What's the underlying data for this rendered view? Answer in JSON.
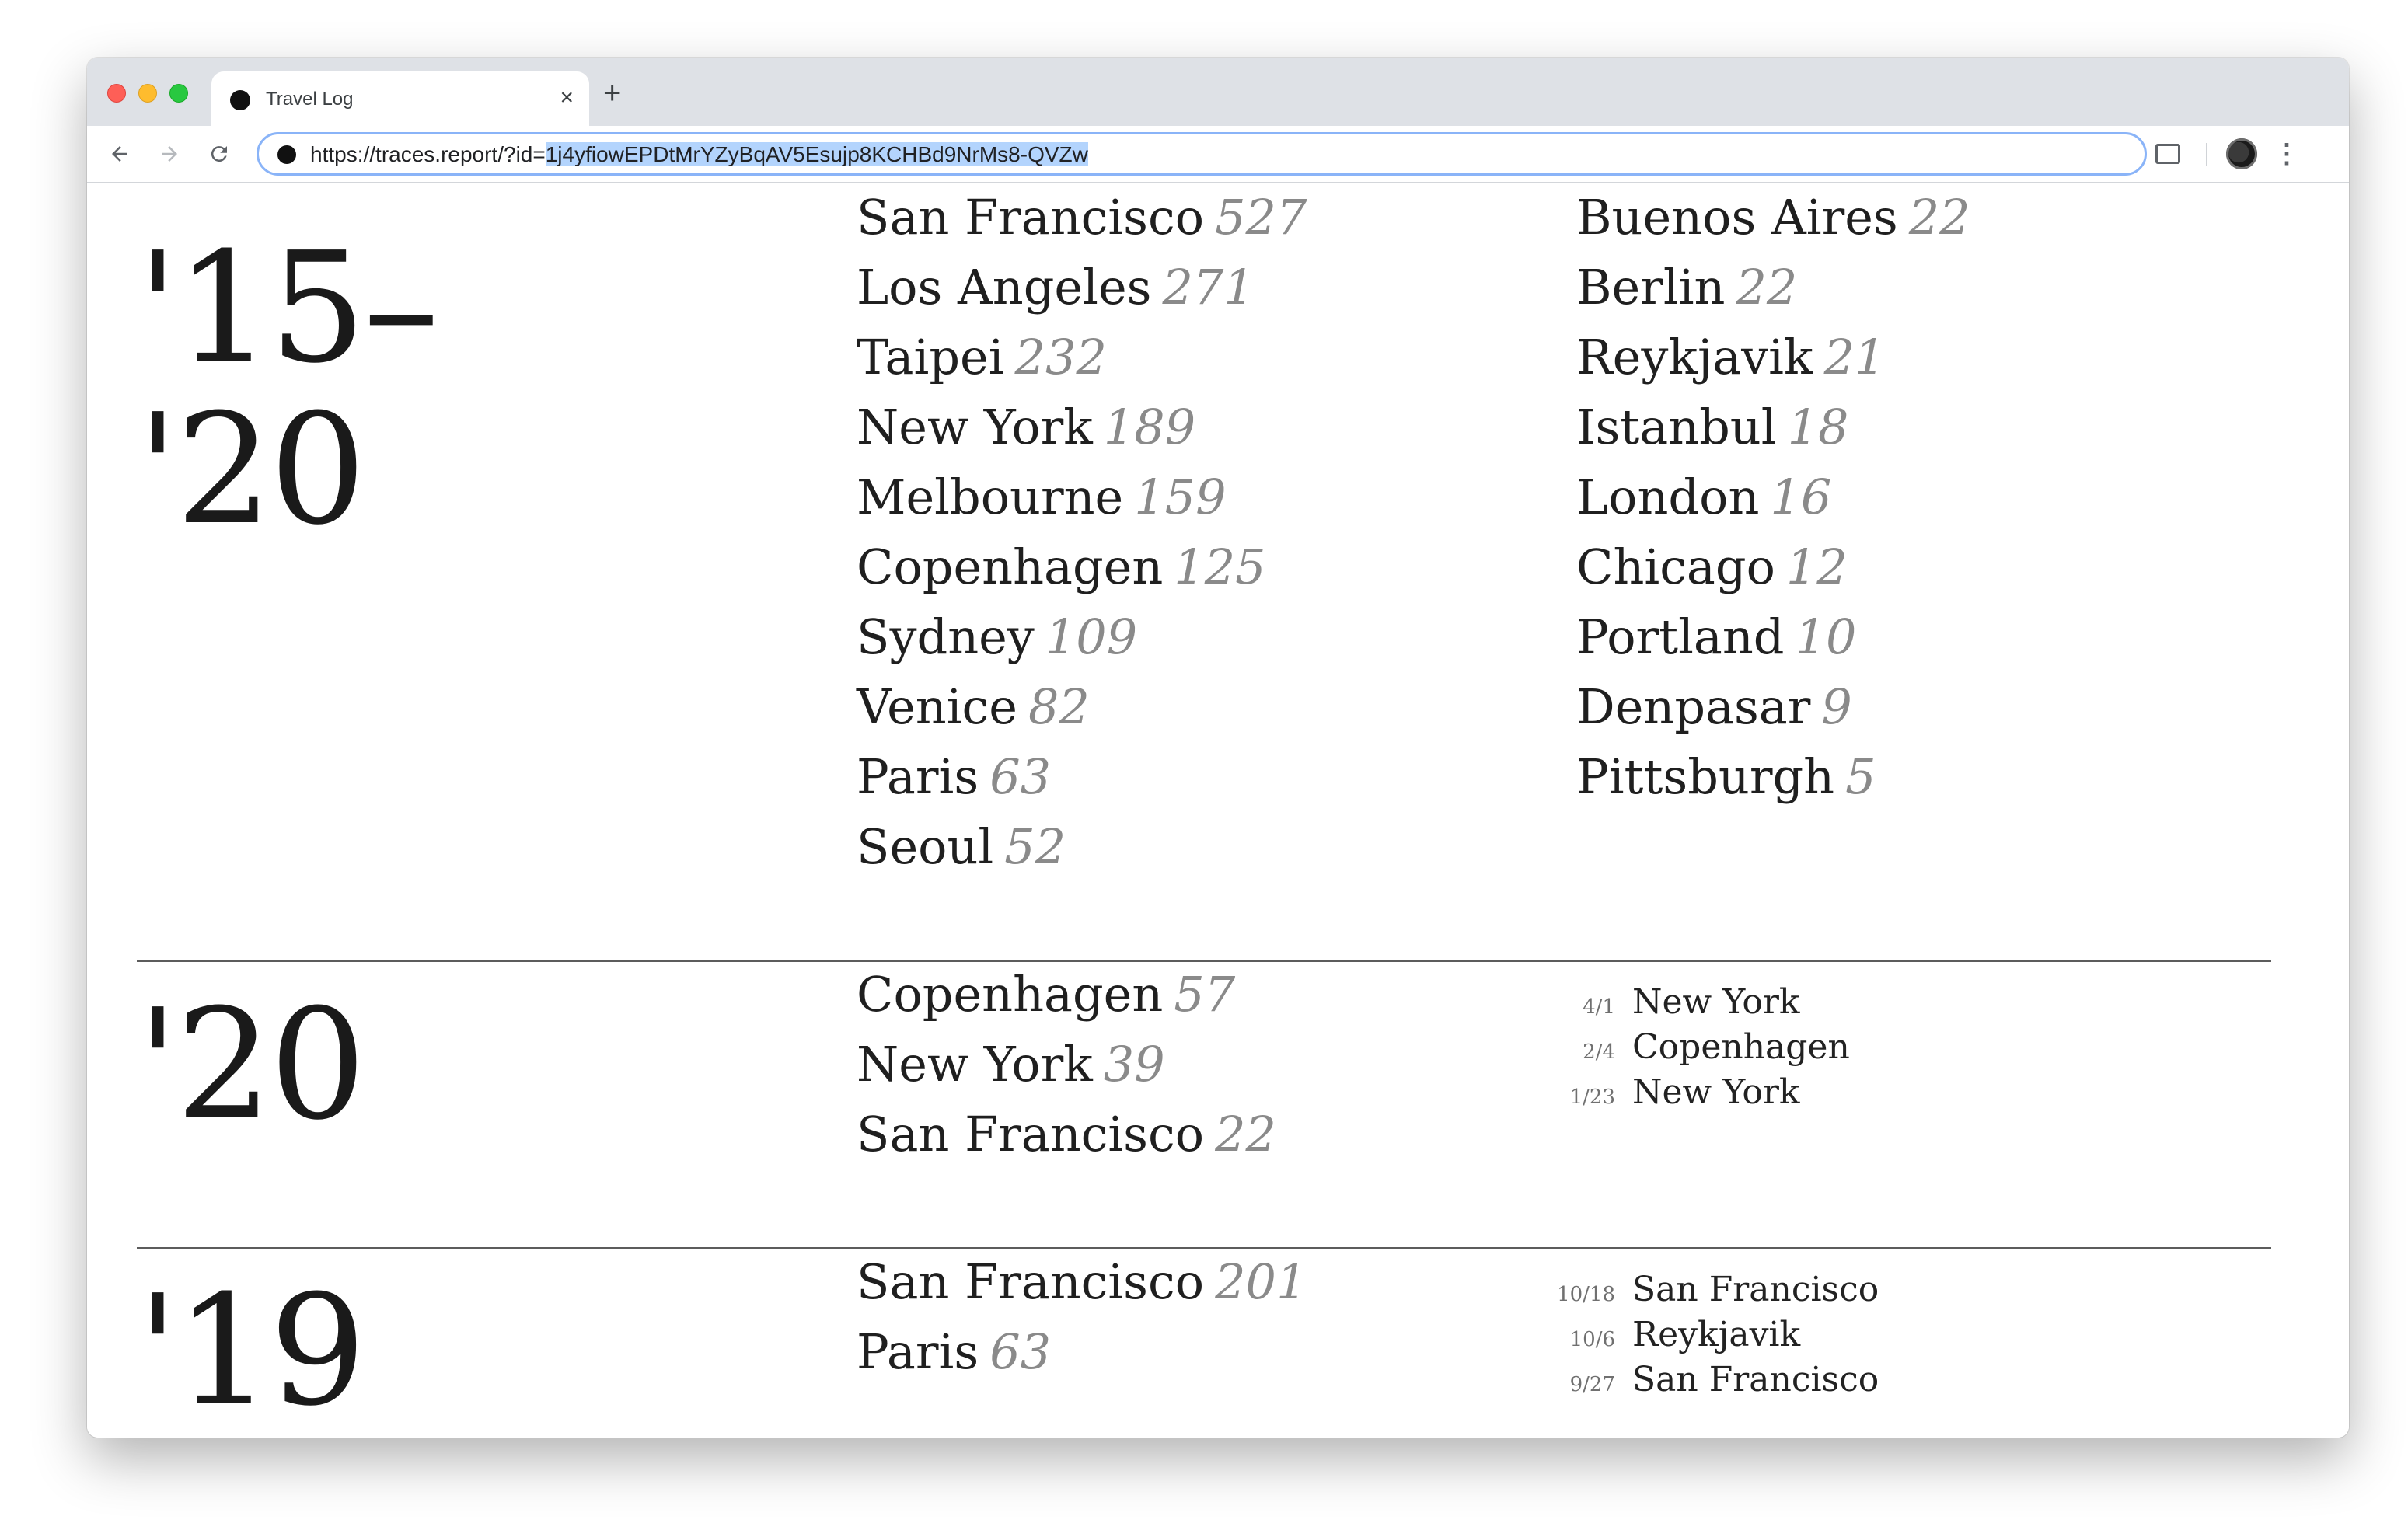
{
  "browser": {
    "tab_title": "Travel Log",
    "tab_close": "×",
    "new_tab": "+",
    "url_prefix": "https://traces.report/?id=",
    "url_selected": "1j4yfiowEPDtMrYZyBqAV5Esujp8KCHBd9NrMs8-QVZw",
    "icons": [
      "back-icon",
      "forward-icon",
      "reload-icon",
      "site-info-icon",
      "screenshot-icon",
      "avatar",
      "menu-icon"
    ]
  },
  "sections": [
    {
      "year": "'15–\n'20",
      "cities": [
        {
          "name": "San Francisco",
          "count": "527"
        },
        {
          "name": "Los Angeles",
          "count": "271"
        },
        {
          "name": "Taipei",
          "count": "232"
        },
        {
          "name": "New York",
          "count": "189"
        },
        {
          "name": "Melbourne",
          "count": "159"
        },
        {
          "name": "Copenhagen",
          "count": "125"
        },
        {
          "name": "Sydney",
          "count": "109"
        },
        {
          "name": "Venice",
          "count": "82"
        },
        {
          "name": "Paris",
          "count": "63"
        },
        {
          "name": "Seoul",
          "count": "52"
        }
      ],
      "cities_right": [
        {
          "name": "Buenos Aires",
          "count": "22"
        },
        {
          "name": "Berlin",
          "count": "22"
        },
        {
          "name": "Reykjavik",
          "count": "21"
        },
        {
          "name": "Istanbul",
          "count": "18"
        },
        {
          "name": "London",
          "count": "16"
        },
        {
          "name": "Chicago",
          "count": "12"
        },
        {
          "name": "Portland",
          "count": "10"
        },
        {
          "name": "Denpasar",
          "count": "9"
        },
        {
          "name": "Pittsburgh",
          "count": "5"
        }
      ]
    },
    {
      "year": "'20",
      "cities": [
        {
          "name": "Copenhagen",
          "count": "57"
        },
        {
          "name": "New York",
          "count": "39"
        },
        {
          "name": "San Francisco",
          "count": "22"
        }
      ],
      "trips": [
        {
          "date": "4/1",
          "place": "New York"
        },
        {
          "date": "2/4",
          "place": "Copenhagen"
        },
        {
          "date": "1/23",
          "place": "New York"
        }
      ]
    },
    {
      "year": "'19",
      "cities": [
        {
          "name": "San Francisco",
          "count": "201"
        },
        {
          "name": "Paris",
          "count": "63"
        }
      ],
      "trips": [
        {
          "date": "10/18",
          "place": "San Francisco"
        },
        {
          "date": "10/6",
          "place": "Reykjavik"
        },
        {
          "date": "9/27",
          "place": "San Francisco"
        }
      ]
    }
  ]
}
